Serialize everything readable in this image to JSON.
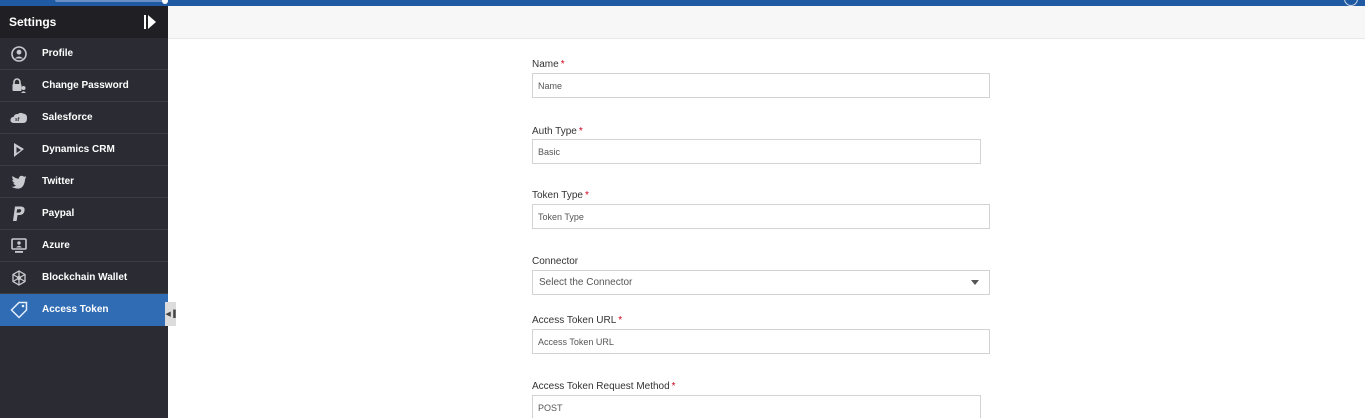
{
  "sidebar": {
    "title": "Settings",
    "items": [
      {
        "label": "Profile",
        "icon": "user-circle-icon",
        "active": false
      },
      {
        "label": "Change Password",
        "icon": "lock-user-icon",
        "active": false
      },
      {
        "label": "Salesforce",
        "icon": "salesforce-icon",
        "active": false
      },
      {
        "label": "Dynamics CRM",
        "icon": "dynamics-icon",
        "active": false
      },
      {
        "label": "Twitter",
        "icon": "twitter-icon",
        "active": false
      },
      {
        "label": "Paypal",
        "icon": "paypal-icon",
        "active": false
      },
      {
        "label": "Azure",
        "icon": "monitor-user-icon",
        "active": false
      },
      {
        "label": "Blockchain Wallet",
        "icon": "blockchain-icon",
        "active": false
      },
      {
        "label": "Access Token",
        "icon": "tag-icon",
        "active": true
      }
    ]
  },
  "form": {
    "name": {
      "label": "Name",
      "required_mark": "*",
      "placeholder": "Name"
    },
    "auth_type": {
      "label": "Auth Type",
      "required_mark": "*",
      "value": "Basic"
    },
    "token_type": {
      "label": "Token Type",
      "required_mark": "*",
      "placeholder": "Token Type"
    },
    "connector": {
      "label": "Connector",
      "selected": "Select the Connector"
    },
    "access_token_url": {
      "label": "Access Token URL",
      "required_mark": "*",
      "placeholder": "Access Token URL"
    },
    "request_method": {
      "label": "Access Token Request Method",
      "required_mark": "*",
      "value": "POST"
    }
  },
  "colors": {
    "topbar": "#1f5aa3",
    "sidebar_bg": "#2b2c33",
    "active_item": "#2f6cb4",
    "required": "#d0021b"
  }
}
